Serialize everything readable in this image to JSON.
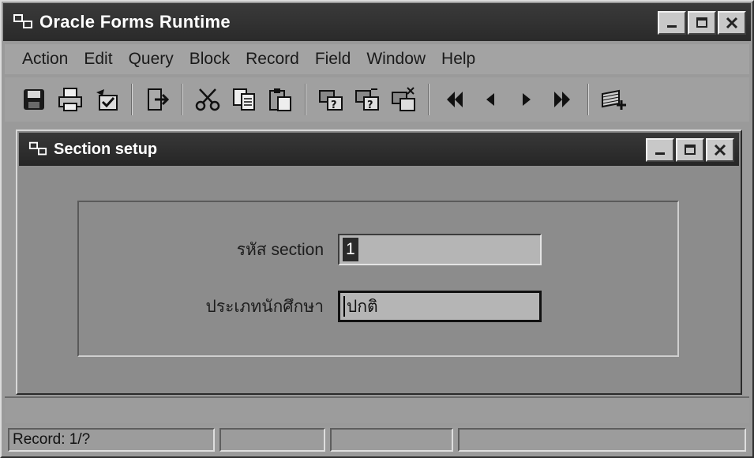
{
  "app": {
    "title": "Oracle Forms Runtime"
  },
  "menu": [
    {
      "label": "Action"
    },
    {
      "label": "Edit"
    },
    {
      "label": "Query"
    },
    {
      "label": "Block"
    },
    {
      "label": "Record"
    },
    {
      "label": "Field"
    },
    {
      "label": "Window"
    },
    {
      "label": "Help"
    }
  ],
  "toolbar": {
    "icons": [
      "save-icon",
      "print-icon",
      "clear-icon",
      "exit-icon",
      "cut-icon",
      "copy-icon",
      "paste-icon",
      "enter-query-icon",
      "execute-query-icon",
      "cancel-query-icon",
      "previous-block-icon",
      "previous-record-icon",
      "next-record-icon",
      "next-block-icon",
      "insert-record-icon"
    ]
  },
  "section_window": {
    "title": "Section setup"
  },
  "form": {
    "section_label": "รหัส section",
    "section_value": "1",
    "student_type_label": "ประเภทนักศึกษา",
    "student_type_value": "ปกติ"
  },
  "statusbar": {
    "record": "Record: 1/?"
  }
}
